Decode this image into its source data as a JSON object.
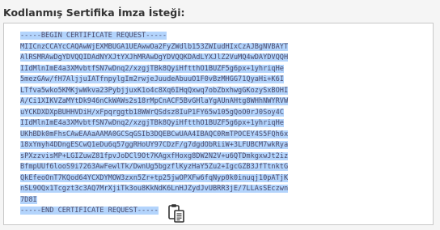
{
  "heading": "Kodlanmış Sertifika İmza İsteği:",
  "csr_lines": [
    "-----BEGIN CERTIFICATE REQUEST-----",
    "MIICnzCCAYcCAQAwWjEXMBUGA1UEAwwOa2FyZWdlb153ZWIudHIxCzAJBgNVBAYT",
    "AlRSMRAwDgYDVQQIDAdNYXJtYXJhMRAwDgYDVQQKDAdLYXJlZ2VuMQ4wDAYDVQQH",
    "IIdMlnImE4a3XMvbtfSN7wDnq2/xzgjTBk8QyiHftthO1BUZF5g6px+1yhriqHe",
    "5mezGAw/fH7AljjuIATfnpylgIm2rwjeJuudeAbuuO1F0vBzMHGG71QyaHi+K6I",
    "LTfva5wko5KMKjwWkva23PybjjuxK1o4c8Xq6IHqQxwq7obZbxhwgGKozySxBOHI",
    "A/Ci1XIKVZaMYtDk946nCkWAWs2s18rMpCnACF5BvGHlaYgAUnAHtg8WHhNWYRVW",
    "uYCKDXDXpBUHHVDiH/xFpqrggtb18WWrQSdsz8IuP1FY65w105gQoO0rJ0Soy4C",
    "IIdMlnImE4a3XMvbtfSN7wDnq2/xzgjTBk8QyiHftthO1BUZF5g6px+1yhriqHe",
    "UKhBDk0mFhsCAwEAAaAAMA0GCSqGSIb3DQEBCwUAA4IBAQC0RmTPOCEY4S5FQh6x",
    "18xYmyh4DDngESCwQ1eDu6q57ggRHoUY97CDzF/g7dgdObRiiW+3LFUBCM7wkRya",
    "sPXzzvisMP+LGIZuwZ81fpvJoDCl9Ot7KAgxfHoxg8DW2N2V+u6QTDmkgxwJt2iz",
    "BfmpUUf6looS9i7263AwFewlTk/DwnUg5bgzflKyzHaY5Zu2+IgcGZB3JfTtnktG",
    "QkEfeoOnT7KQod64YCXDYMOW3zxn5Zr+tp25jwOPXFw6fqNyp0k0inuqj10pATjK",
    "nSL9OQx1Tcgzt3c3AQ7MrXjiTk3ou8KkNdK6LnHJZydJvUBRR3jE/7LLAsSEczwn",
    "7D8I",
    "-----END CERTIFICATE REQUEST-----"
  ],
  "icons": {
    "copy": "copy-to-clipboard-icon"
  },
  "colors": {
    "selection_highlight": "#b3d4fc",
    "code_text": "#4a4a6a",
    "panel_background": "#f5f5f5"
  }
}
